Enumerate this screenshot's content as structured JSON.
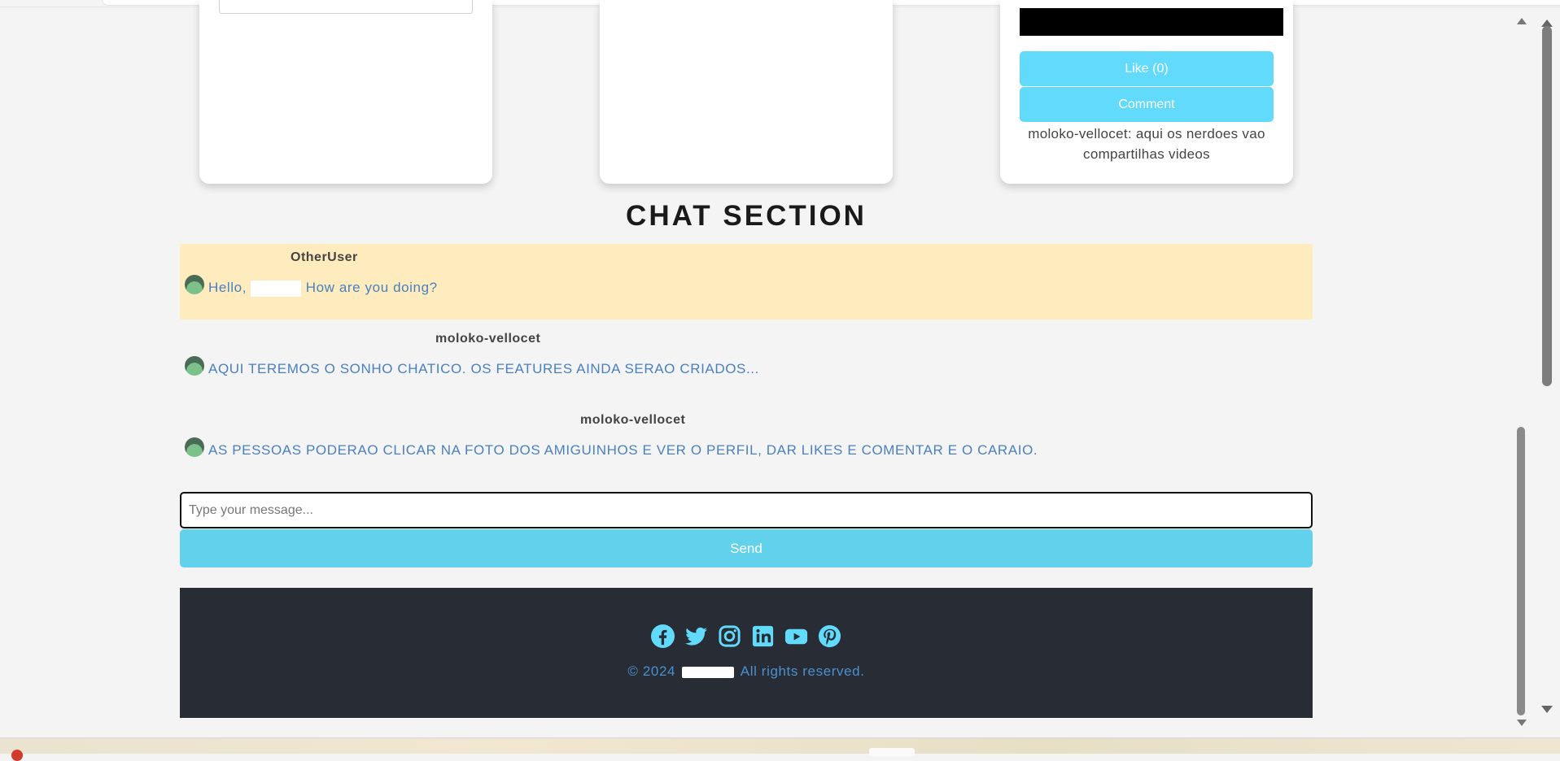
{
  "cards": {
    "video_card": {
      "like_label": "Like (0)",
      "comment_label": "Comment",
      "caption": "moloko-vellocet: aqui os nerdoes vao compartilhas videos"
    }
  },
  "chat": {
    "title": "CHAT SECTION",
    "messages": [
      {
        "sender": "OtherUser",
        "text_before": "Hello, ",
        "text_after": " How are you doing?",
        "highlighted": true
      },
      {
        "sender": "moloko-vellocet",
        "text": "AQUI TEREMOS O SONHO CHATICO. OS FEATURES AINDA SERAO CRIADOS..."
      },
      {
        "sender": "moloko-vellocet",
        "text": "AS PESSOAS PODERAO CLICAR NA FOTO DOS AMIGUINHOS E VER O PERFIL, DAR LIKES E COMENTAR E O CARAIO."
      }
    ],
    "input_placeholder": "Type your message...",
    "send_label": "Send"
  },
  "footer": {
    "social_icons": [
      "facebook-icon",
      "twitter-icon",
      "instagram-icon",
      "linkedin-icon",
      "youtube-icon",
      "pinterest-icon"
    ],
    "icon_color": "#61dafb",
    "copyright_prefix": "© 2024 ",
    "copyright_suffix": " All rights reserved."
  },
  "colors": {
    "accent": "#61dafb",
    "footer_bg": "#282c34",
    "highlight_bg": "#ffecbe",
    "message_text": "#4a80c0"
  }
}
